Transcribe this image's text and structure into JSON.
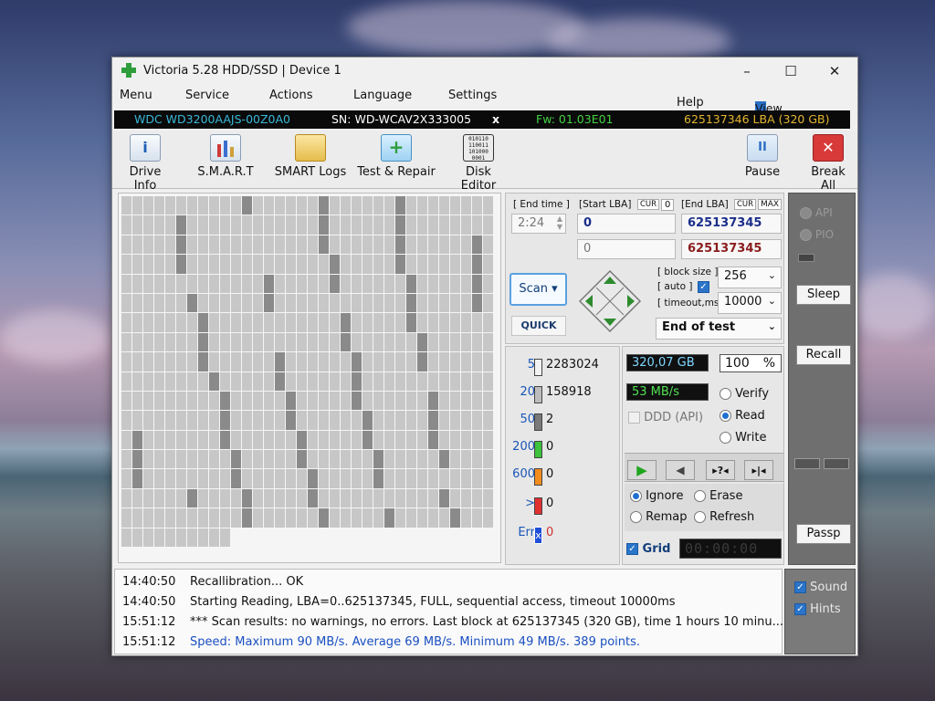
{
  "window": {
    "title": "Victoria 5.28 HDD/SSD | Device 1",
    "controls": {
      "minimize": "–",
      "maximize": "☐",
      "close": "✕"
    }
  },
  "menu": {
    "items": [
      "Menu",
      "Service",
      "Actions",
      "Language",
      "Settings"
    ],
    "help": "Help",
    "view_buffer": "View Buffer Live"
  },
  "device": {
    "model": "WDC WD3200AAJS-00Z0A0",
    "serial": "SN: WD-WCAV2X333005",
    "close": "x",
    "firmware": "Fw: 01.03E01",
    "capacity": "625137346 LBA (320 GB)"
  },
  "toolbar": {
    "drive_info": "Drive Info",
    "smart": "S.M.A.R.T",
    "smart_logs": "SMART Logs",
    "test_repair": "Test & Repair",
    "disk_editor": "Disk Editor",
    "disk_editor_icon_text": "010110\n110011\n101000\n0001",
    "pause": "Pause",
    "break_all": "Break All",
    "colors": {
      "break_all": "#d83a3a",
      "active_tab": "#9fd2f3"
    }
  },
  "scan_map": {
    "columns": 34,
    "rows": 18,
    "colors": {
      "normal": "#c7c7c7",
      "slow": "#8a8a8a"
    }
  },
  "test_params": {
    "end_time_label": "[ End time ]",
    "end_time": "2:24",
    "start_lba_label": "[Start LBA]",
    "cur_label": "CUR",
    "start_cur_value": "0",
    "start_lba": "0",
    "start_lba_2": "0",
    "end_lba_label": "[End LBA]",
    "end_cur_label": "CUR",
    "max_label": "MAX",
    "end_lba": "625137345",
    "end_lba_2": "625137345",
    "block_size_label": "[ block size ]",
    "auto_label": "[ auto ]",
    "block_size": "256",
    "timeout_label": "[ timeout,ms ]",
    "timeout": "10000",
    "after_test": "End of test",
    "scan_button": "Scan",
    "quick_button": "QUICK"
  },
  "stats": {
    "rows": [
      {
        "threshold": "5",
        "count": "2283024",
        "color": "#f2f2f2"
      },
      {
        "threshold": "20",
        "count": "158918",
        "color": "#bdbdbd"
      },
      {
        "threshold": "50",
        "count": "2",
        "color": "#7a7a7a"
      },
      {
        "threshold": "200",
        "count": "0",
        "color": "#3cc23c"
      },
      {
        "threshold": "600",
        "count": "0",
        "color": "#f28c1c"
      },
      {
        "threshold": ">",
        "count": "0",
        "color": "#e03030"
      },
      {
        "threshold": "Err",
        "count": "0",
        "color": "#1f4fd8"
      }
    ]
  },
  "progress": {
    "size": "320,07 GB",
    "percent_value": "100",
    "percent_sign": "%",
    "speed": "53 MB/s",
    "ddd_label": "DDD (API)",
    "verify": "Verify",
    "read": "Read",
    "write": "Write",
    "mode_selected": "Read",
    "ignore": "Ignore",
    "erase": "Erase",
    "remap": "Remap",
    "refresh": "Refresh",
    "action_selected": "Ignore",
    "grid_label": "Grid",
    "timer": "00:00:00"
  },
  "side": {
    "api": "API",
    "pio": "PIO",
    "sleep": "Sleep",
    "recall": "Recall",
    "passp": "Passp"
  },
  "log": {
    "entries": [
      {
        "time": "14:40:50",
        "text": "Recallibration... OK",
        "color": "#111111"
      },
      {
        "time": "14:40:50",
        "text": "Starting Reading, LBA=0..625137345, FULL, sequential access, timeout 10000ms",
        "color": "#111111"
      },
      {
        "time": "15:51:12",
        "text": "*** Scan results: no warnings, no errors. Last block at 625137345 (320 GB), time 1 hours 10 minu...",
        "color": "#111111"
      },
      {
        "time": "15:51:12",
        "text": "Speed: Maximum 90 MB/s. Average 69 MB/s. Minimum 49 MB/s. 389 points.",
        "color": "#1a4fc0"
      }
    ],
    "sound": "Sound",
    "hints": "Hints"
  }
}
